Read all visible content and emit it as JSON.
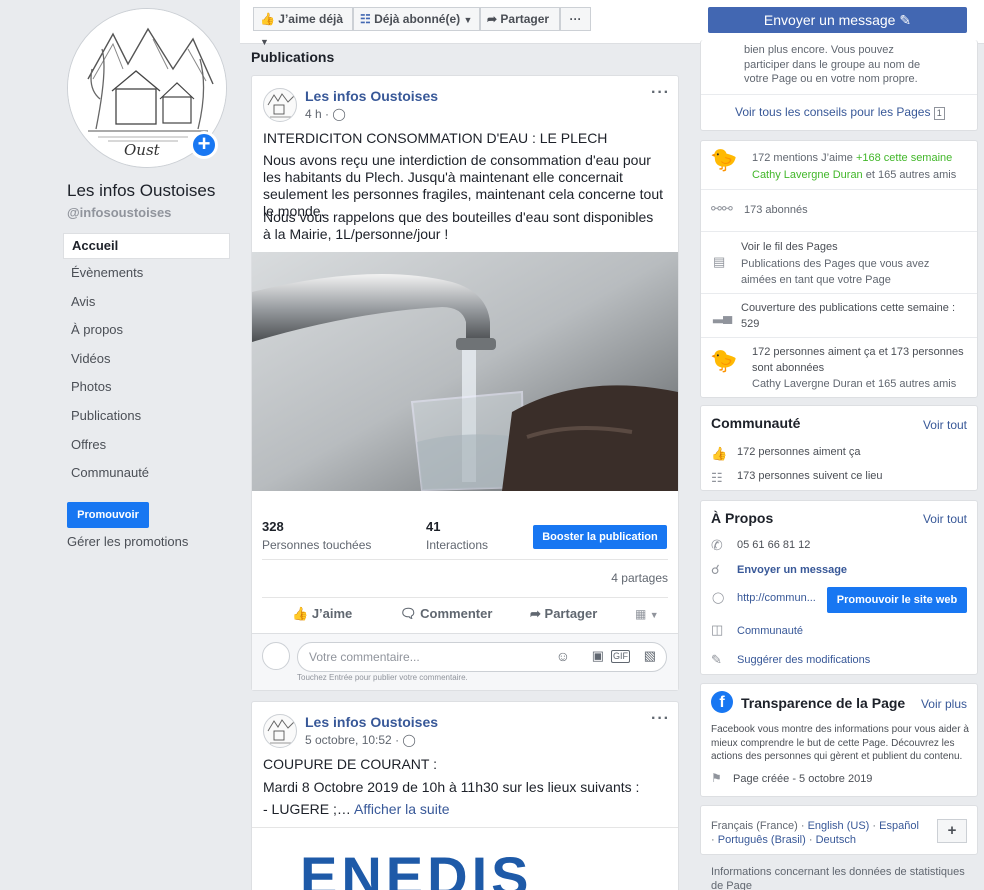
{
  "page": {
    "name": "Les infos Oustoises",
    "handle": "@infosoustoises",
    "avatar_caption": "Oust"
  },
  "left_nav": {
    "items": [
      {
        "label": "Accueil",
        "active": true
      },
      {
        "label": "Évènements"
      },
      {
        "label": "Avis"
      },
      {
        "label": "À propos"
      },
      {
        "label": "Vidéos"
      },
      {
        "label": "Photos"
      },
      {
        "label": "Publications"
      },
      {
        "label": "Offres"
      },
      {
        "label": "Communauté"
      }
    ],
    "promote_button": "Promouvoir",
    "manage_promotions": "Gérer les promotions"
  },
  "topbar": {
    "like": "J’aime déjà",
    "subscribed": "Déjà abonné(e)",
    "share": "Partager",
    "more": "···",
    "send_message": "Envoyer un message"
  },
  "feed": {
    "section_title": "Publications",
    "post1": {
      "author": "Les infos Oustoises",
      "time": "4 h ·",
      "title": "INTERDICITON CONSOMMATION D'EAU : LE PLECH",
      "para1": "Nous avons reçu une interdiction de consommation d'eau pour les habitants du Plech. Jusqu'à maintenant elle concernait seulement les personnes fragiles, maintenant cela concerne tout le monde.",
      "para2": "Nous vous rappelons que des bouteilles d'eau sont disponibles à la Mairie, 1L/personne/jour !",
      "reach_value": "328",
      "reach_label": "Personnes touchées",
      "interactions_value": "41",
      "interactions_label": "Interactions",
      "boost_button": "Booster la publication",
      "shares": "4 partages",
      "like": "J’aime",
      "comment": "Commenter",
      "share": "Partager",
      "comment_placeholder": "Votre commentaire...",
      "comment_hint": "Touchez Entrée pour publier votre commentaire."
    },
    "post2": {
      "author": "Les infos Oustoises",
      "time": "5 octobre, 10:52 ·",
      "line1": "COUPURE DE COURANT :",
      "line2": "Mardi 8 Octobre 2019 de 10h à 11h30 sur les lieux suivants :",
      "line3": "- LUGERE ;…",
      "see_more": "Afficher la suite",
      "image_text": "ENEDIS"
    }
  },
  "right": {
    "tips": {
      "text_lines": [
        "bien plus encore. Vous pouvez",
        "participer dans le groupe au nom de",
        "votre Page ou en votre nom propre."
      ],
      "all_tips": "Voir tous les conseils pour les Pages",
      "badge": "1"
    },
    "stats": {
      "likes": "172 mentions J’aime",
      "likes_week": "+168 cette semaine",
      "friends_like": "Cathy Lavergne Duran",
      "friends_like_rest": "et 165 autres amis",
      "followers": "173 abonnés",
      "feed_title": "Voir le fil des Pages",
      "feed_desc": "Publications des Pages que vous avez aimées en tant que votre Page",
      "reach_title": "Couverture des publications cette semaine :",
      "reach_value": "529",
      "summary": "172 personnes aiment ça et 173 personnes sont abonnées",
      "summary_friends": "Cathy Lavergne Duran et 165 autres amis"
    },
    "community": {
      "title": "Communauté",
      "see_all": "Voir tout",
      "likes": "172 personnes aiment ça",
      "follows": "173 personnes suivent ce lieu"
    },
    "about": {
      "title": "À Propos",
      "see_all": "Voir tout",
      "phone": "05 61 66 81 12",
      "send_message": "Envoyer un message",
      "website": "http://commun...",
      "promote_site": "Promouvoir le site web",
      "category": "Communauté",
      "suggest": "Suggérer des modifications"
    },
    "transparency": {
      "title": "Transparence de la Page",
      "see_more": "Voir plus",
      "desc": "Facebook vous montre des informations pour vous aider à mieux comprendre le but de cette Page. Découvrez les actions des personnes qui gèrent et publient du contenu.",
      "created": "Page créée - 5 octobre 2019"
    },
    "languages": {
      "current": "Français (France)",
      "others": [
        "English (US)",
        "Español",
        "Português (Brasil)",
        "Deutsch"
      ],
      "sep": "·",
      "add": "+"
    },
    "footer": "Informations concernant les données de statistiques de Page"
  },
  "colors": {
    "brand_blue": "#1877f2",
    "header_blue": "#4267b2",
    "link": "#385898",
    "green": "#42b72a",
    "background": "#e9ebee"
  }
}
